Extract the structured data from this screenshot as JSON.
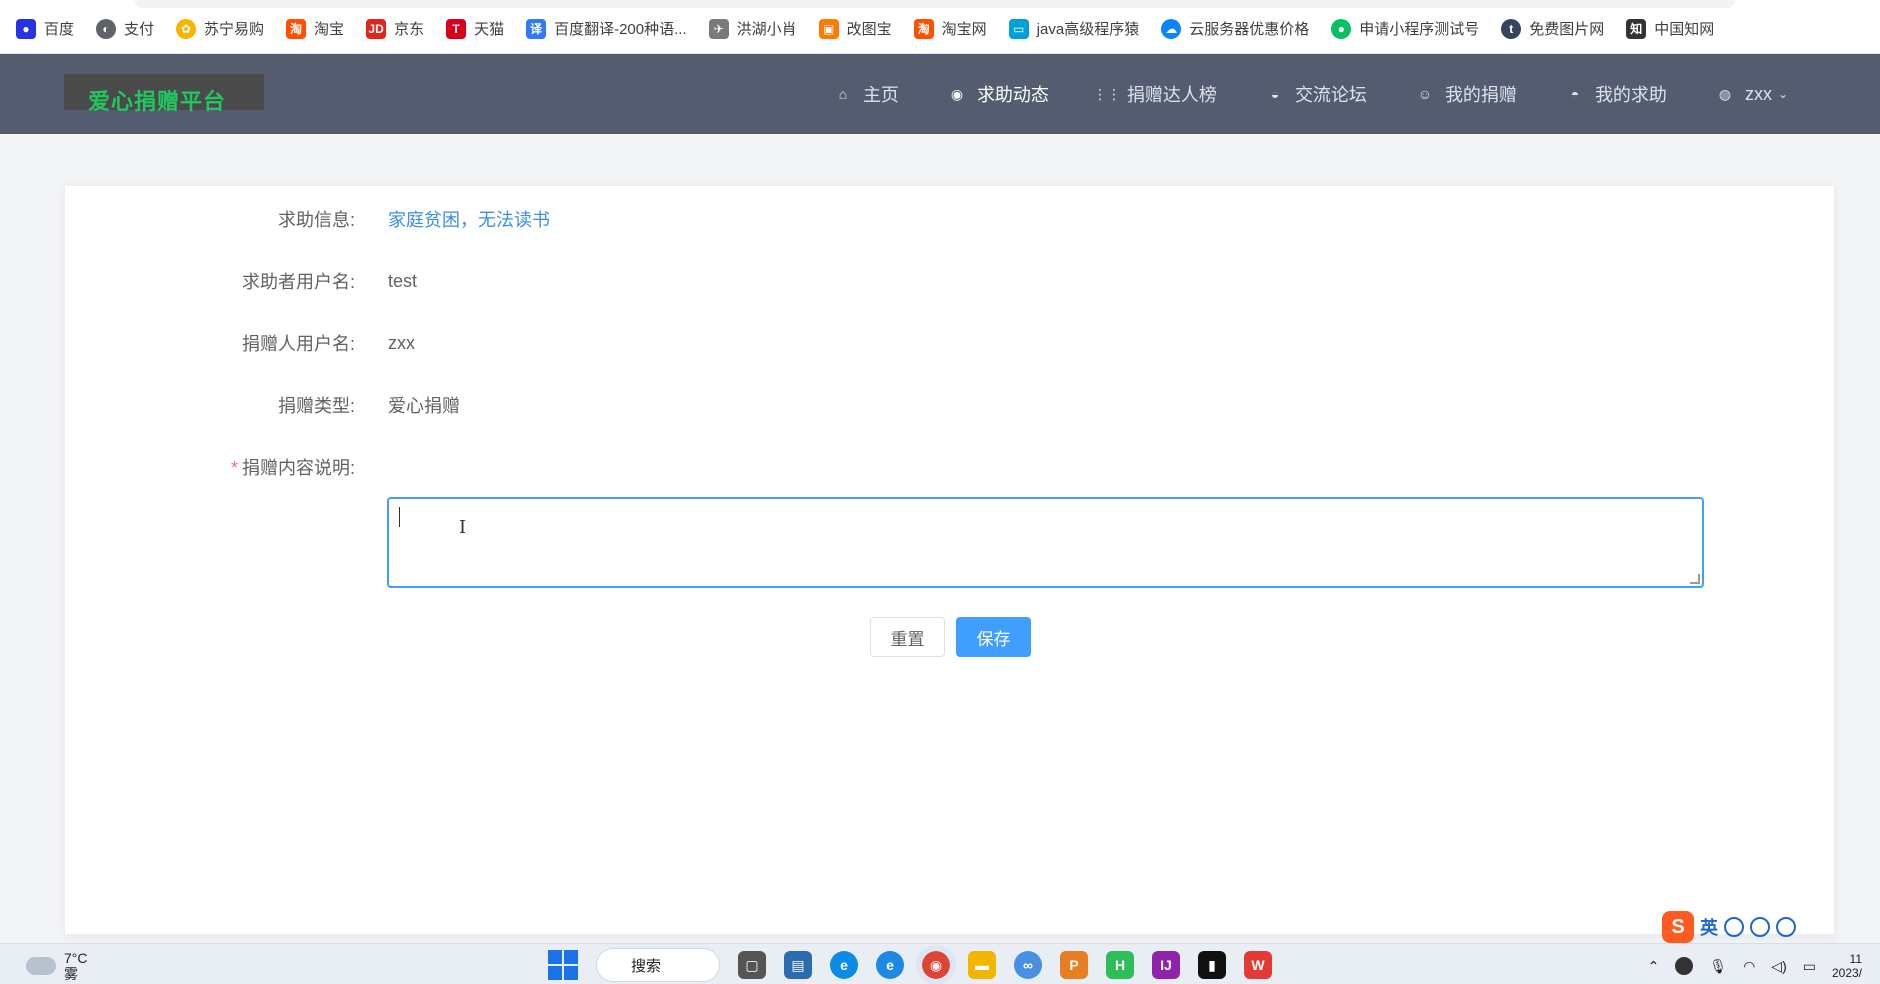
{
  "bookmarks": [
    {
      "label": "百度",
      "icon": "baidu-paw-icon",
      "color": "#2932e1"
    },
    {
      "label": "支付",
      "icon": "globe-icon",
      "color": "#5f6368"
    },
    {
      "label": "苏宁易购",
      "icon": "suning-lion-icon",
      "color": "#f7b500"
    },
    {
      "label": "淘宝",
      "icon": "taobao-icon",
      "color": "#ff5000"
    },
    {
      "label": "京东",
      "icon": "jd-icon",
      "color": "#e1251b"
    },
    {
      "label": "天猫",
      "icon": "tmall-icon",
      "color": "#d9001b"
    },
    {
      "label": "百度翻译-200种语...",
      "icon": "translate-icon",
      "color": "#2f7bf6"
    },
    {
      "label": "洪湖小肖",
      "icon": "bird-icon",
      "color": "#7a7a7a"
    },
    {
      "label": "改图宝",
      "icon": "image-tool-icon",
      "color": "#ff7a00"
    },
    {
      "label": "淘宝网",
      "icon": "taobao-icon",
      "color": "#ff5000"
    },
    {
      "label": "java高级程序猿",
      "icon": "bilibili-icon",
      "color": "#00a1d6"
    },
    {
      "label": "云服务器优惠价格",
      "icon": "cloud-icon",
      "color": "#0a84ff"
    },
    {
      "label": "申请小程序测试号",
      "icon": "wechat-icon",
      "color": "#07c160"
    },
    {
      "label": "免费图片网",
      "icon": "tumblr-icon",
      "color": "#35465c"
    },
    {
      "label": "中国知网",
      "icon": "cnki-icon",
      "color": "#333333"
    }
  ],
  "header": {
    "logo": "爱心捐赠平台",
    "nav": [
      {
        "label": "主页",
        "icon": "home-icon",
        "active": false
      },
      {
        "label": "求助动态",
        "icon": "compass-icon",
        "active": true
      },
      {
        "label": "捐赠达人榜",
        "icon": "grid-icon",
        "active": false
      },
      {
        "label": "交流论坛",
        "icon": "chat-icon",
        "active": false
      },
      {
        "label": "我的捐赠",
        "icon": "smile-icon",
        "active": false
      },
      {
        "label": "我的求助",
        "icon": "help-icon",
        "active": false
      }
    ],
    "user": "zxx"
  },
  "form": {
    "help_info_label": "求助信息:",
    "help_info_value": "家庭贫困，无法读书",
    "requester_label": "求助者用户名:",
    "requester_value": "test",
    "donor_label": "捐赠人用户名:",
    "donor_value": "zxx",
    "type_label": "捐赠类型:",
    "type_value": "爱心捐赠",
    "content_label": "捐赠内容说明:",
    "content_value": "",
    "required_mark": "*",
    "reset_label": "重置",
    "save_label": "保存"
  },
  "ime": {
    "logo": "S",
    "mode": "英"
  },
  "taskbar": {
    "temperature": "7°C",
    "weather": "雾",
    "search_label": "搜索",
    "clock_time": "11",
    "clock_date": "2023/"
  },
  "colors": {
    "header_bg": "#545c70",
    "logo_green": "#22c55e",
    "primary": "#409eff",
    "link": "#3a8ee6",
    "required": "#f56c6c"
  }
}
